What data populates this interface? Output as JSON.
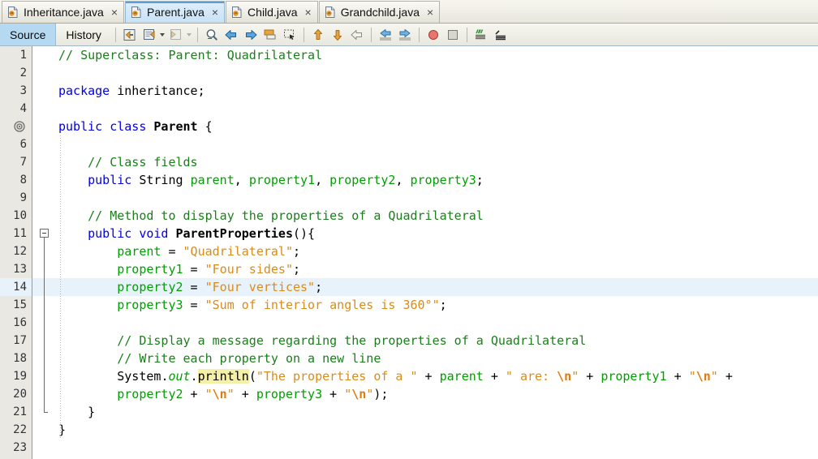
{
  "tabs": [
    {
      "label": "Inheritance.java",
      "icon": "java-file-icon",
      "active": false,
      "close": "×"
    },
    {
      "label": "Parent.java",
      "icon": "java-file-icon",
      "active": true,
      "close": "×"
    },
    {
      "label": "Child.java",
      "icon": "java-file-icon",
      "active": false,
      "close": "×"
    },
    {
      "label": "Grandchild.java",
      "icon": "java-file-icon",
      "active": false,
      "close": "×"
    }
  ],
  "view_tabs": [
    {
      "label": "Source",
      "active": true
    },
    {
      "label": "History",
      "active": false
    }
  ],
  "toolbar": {
    "buttons": [
      {
        "name": "last-edit-icon"
      },
      {
        "name": "back-edit-icon"
      },
      {
        "name": "forward-edit-icon"
      },
      {
        "name": "find-selection-icon"
      },
      {
        "name": "previous-bookmark-icon"
      },
      {
        "name": "next-bookmark-icon"
      },
      {
        "name": "toggle-bookmark-icon"
      },
      {
        "name": "rectangular-selection-icon"
      },
      {
        "name": "previous-error-icon"
      },
      {
        "name": "next-error-icon"
      },
      {
        "name": "shift-line-left-icon"
      },
      {
        "name": "shift-line-right-icon"
      },
      {
        "name": "start-macro-recording-icon"
      },
      {
        "name": "stop-macro-recording-icon"
      },
      {
        "name": "comment-icon"
      },
      {
        "name": "uncomment-icon"
      }
    ]
  },
  "editor": {
    "current_line": 14,
    "highlight_token": "println",
    "line_count": 23,
    "fold_start_line": 11,
    "fold_end_line": 21,
    "annotation_line": 5,
    "annotation_icon": "is-overridden-icon",
    "colors": {
      "keyword": "#0000e6",
      "comment": "#1a7f1a",
      "string": "#d98c1a",
      "field": "#00a000",
      "escape": "#e07b10",
      "current_line_bg": "#e8f2fb",
      "occurrence_bg": "#f5f0a8",
      "gutter_bg": "#e9e8e2",
      "editor_bg": "#ffffff"
    },
    "lines": [
      {
        "n": 1,
        "text": "// Superclass: Parent: Quadrilateral"
      },
      {
        "n": 2,
        "text": ""
      },
      {
        "n": 3,
        "text": "package inheritance;"
      },
      {
        "n": 4,
        "text": ""
      },
      {
        "n": 5,
        "text": "public class Parent {"
      },
      {
        "n": 6,
        "text": ""
      },
      {
        "n": 7,
        "text": "    // Class fields"
      },
      {
        "n": 8,
        "text": "    public String parent, property1, property2, property3;"
      },
      {
        "n": 9,
        "text": ""
      },
      {
        "n": 10,
        "text": "    // Method to display the properties of a Quadrilateral"
      },
      {
        "n": 11,
        "text": "    public void ParentProperties(){"
      },
      {
        "n": 12,
        "text": "        parent = \"Quadrilateral\";"
      },
      {
        "n": 13,
        "text": "        property1 = \"Four sides\";"
      },
      {
        "n": 14,
        "text": "        property2 = \"Four vertices\";"
      },
      {
        "n": 15,
        "text": "        property3 = \"Sum of interior angles is 360°\";"
      },
      {
        "n": 16,
        "text": ""
      },
      {
        "n": 17,
        "text": "        // Display a message regarding the properties of a Quadrilateral"
      },
      {
        "n": 18,
        "text": "        // Write each property on a new line"
      },
      {
        "n": 19,
        "text": "        System.out.println(\"The properties of a \" + parent + \" are: \\n\" + property1 + \"\\n\" +"
      },
      {
        "n": 20,
        "text": "        property2 + \"\\n\" + property3 + \"\\n\");"
      },
      {
        "n": 21,
        "text": "    }"
      },
      {
        "n": 22,
        "text": "}"
      },
      {
        "n": 23,
        "text": ""
      }
    ]
  }
}
